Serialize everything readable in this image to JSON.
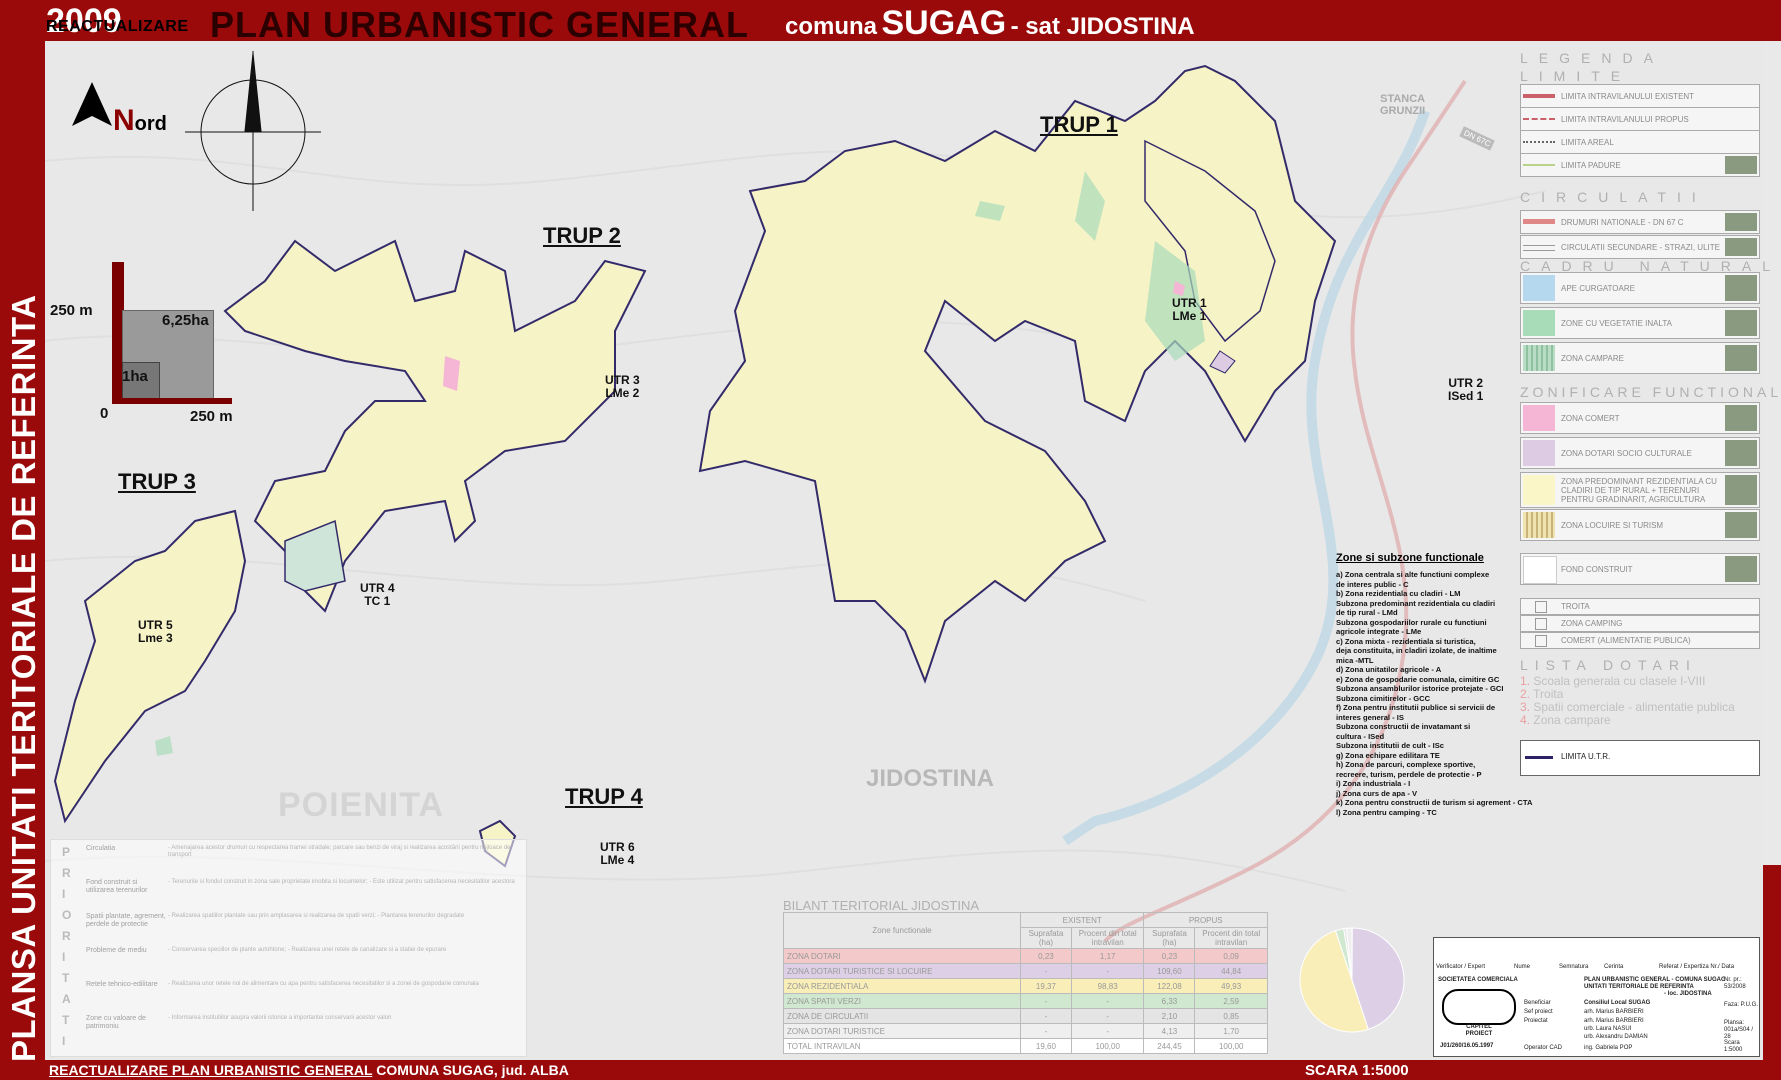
{
  "header": {
    "year": "2009",
    "reactualizare": "REACTUALIZARE",
    "main_title": "PLAN URBANISTIC GENERAL",
    "comuna_prefix": "comuna",
    "comuna_name": "SUGAG",
    "sat": "- sat JIDOSTINA"
  },
  "vertical_title": "PLANSA UNITATI TERITORIALE DE REFERINTA",
  "footer": {
    "left_part1": "REACTUALIZARE PLAN URBANISTIC GENERAL",
    "left_part2": "COMUNA SUGAG",
    "left_part3": ", jud. ALBA",
    "scale": "SCARA 1:5000"
  },
  "north": {
    "n": "N",
    "rest": "ord"
  },
  "scale_graphic": {
    "label_250_left": "250 m",
    "label_625": "6,25ha",
    "label_1ha": "1ha",
    "label_0": "0",
    "label_250_bottom": "250 m"
  },
  "trups": [
    {
      "label": "TRUP 1"
    },
    {
      "label": "TRUP 2"
    },
    {
      "label": "TRUP 3"
    },
    {
      "label": "TRUP 4"
    }
  ],
  "utrs": [
    {
      "line1": "UTR 1",
      "line2": "LMe 1"
    },
    {
      "line1": "UTR 2",
      "line2": "ISed 1"
    },
    {
      "line1": "UTR 3",
      "line2": "LMe 2"
    },
    {
      "line1": "UTR 4",
      "line2": "TC 1"
    },
    {
      "line1": "UTR 5",
      "line2": "Lme 3"
    },
    {
      "line1": "UTR 6",
      "line2": "LMe 4"
    }
  ],
  "places": {
    "poienita": "POIENITA",
    "jidostina": "JIDOSTINA",
    "stanca": "STANCA",
    "grunzii": "GRUNZII",
    "road": "DN 67C"
  },
  "legend": {
    "title": "LEGENDA",
    "limite_head": "LIMITE",
    "limite": [
      {
        "label": "LIMITA INTRAVILANULUI EXISTENT"
      },
      {
        "label": "LIMITA INTRAVILANULUI PROPUS"
      },
      {
        "label": "LIMITA AREAL"
      },
      {
        "label": "LIMITA PADURE"
      }
    ],
    "circulatii_head": "CIRCULATII",
    "circulatii": [
      {
        "label": "DRUMURI NATIONALE - DN 67 C"
      },
      {
        "label": "CIRCULATII SECUNDARE - STRAZI, ULITE"
      }
    ],
    "cadru_head": "CADRU NATURAL",
    "cadru": [
      {
        "label": "APE CURGATOARE",
        "color": "#b5d8ef"
      },
      {
        "label": "ZONE CU VEGETATIE INALTA",
        "color": "#a8dcb8"
      },
      {
        "label": "ZONA CAMPARE",
        "color": "#b8dcc4"
      }
    ],
    "zonificare_head": "ZONIFICARE FUNCTIONALA",
    "zonificare": [
      {
        "label": "ZONA COMERT",
        "color": "#f4b6d4"
      },
      {
        "label": "ZONA DOTARI SOCIO CULTURALE",
        "color": "#dccbe3"
      },
      {
        "label": "ZONA PREDOMINANT REZIDENTIALA CU CLADIRI DE TIP RURAL + TERENURI PENTRU GRADINARIT, AGRICULTURA",
        "color": "#fbf6c8"
      },
      {
        "label": "ZONA LOCUIRE SI TURISM",
        "color": "#efe4b0"
      },
      {
        "label": "FOND CONSTRUIT",
        "color": "#ffffff"
      }
    ],
    "small": [
      {
        "label": "TROITA"
      },
      {
        "label": "ZONA CAMPING"
      },
      {
        "label": "COMERT (ALIMENTATIE PUBLICA)"
      }
    ],
    "dotari_head": "LISTA DOTARI",
    "dotari": [
      {
        "n": "1.",
        "label": "Scoala generala cu clasele I-VIII"
      },
      {
        "n": "2.",
        "label": "Troita"
      },
      {
        "n": "3.",
        "label": "Spatii comerciale - alimentatie publica"
      },
      {
        "n": "4.",
        "label": "Zona campare"
      }
    ],
    "utr_limit": "LIMITA U.T.R."
  },
  "zones": {
    "title": "Zone si subzone functionale",
    "items": [
      "a) Zona centrala si alte functiuni complexe",
      "de interes public - C",
      "b) Zona rezidentiala cu cladiri - LM",
      "Subzona predominant rezidentiala cu cladiri",
      "de tip rural - LMd",
      "Subzona gospodariilor rurale cu functiuni",
      "agricole integrate - LMe",
      "c) Zona mixta - rezidentiala si turistica,",
      "deja constituita, in cladiri izolate, de inaltime",
      "mica -MTL",
      "d) Zona unitatilor agricole - A",
      "e) Zona de gospodarie comunala, cimitire GC",
      "Subzona ansamblurilor istorice protejate - GCI",
      "Subzona cimitirelor - GCC",
      "f) Zona pentru institutii publice si servicii de",
      "interes general - IS",
      "Subzona constructii de invatamant si",
      "cultura - ISed",
      "Subzona institutii de cult - ISc",
      "g) Zona echipare edilitara TE",
      "h) Zona de parcuri, complexe sportive,",
      "recreere, turism, perdele de protectie - P",
      "i) Zona industriala - I",
      "j) Zona curs de apa - V",
      "k) Zona pentru constructii de turism si agrement - CTA",
      "l) Zona pentru camping - TC"
    ]
  },
  "bilant": {
    "title": "BILANT TERITORIAL JIDOSTINA",
    "head_zone": "Zone functionale",
    "head_existent": "EXISTENT",
    "head_propus": "PROPUS",
    "head_sup": "Suprafata (ha)",
    "head_proc": "Procent din total intravilan",
    "rows": [
      {
        "name": "ZONA DOTARI",
        "e_sup": "0,23",
        "e_proc": "1,17",
        "p_sup": "0,23",
        "p_proc": "0,09",
        "color": "#f3c9c9"
      },
      {
        "name": "ZONA DOTARI TURISTICE SI LOCUIRE",
        "e_sup": "-",
        "e_proc": "-",
        "p_sup": "109,60",
        "p_proc": "44,84",
        "color": "#ddd0e6"
      },
      {
        "name": "ZONA REZIDENTIALA",
        "e_sup": "19,37",
        "e_proc": "98,83",
        "p_sup": "122,08",
        "p_proc": "49,93",
        "color": "#f9eeb8"
      },
      {
        "name": "ZONA SPATII VERZI",
        "e_sup": "-",
        "e_proc": "-",
        "p_sup": "6,33",
        "p_proc": "2,59",
        "color": "#cfe8cf"
      },
      {
        "name": "ZONA DE CIRCULATII",
        "e_sup": "-",
        "e_proc": "-",
        "p_sup": "2,10",
        "p_proc": "0,85",
        "color": "#e4e4e4"
      },
      {
        "name": "ZONA DOTARI TURISTICE",
        "e_sup": "-",
        "e_proc": "-",
        "p_sup": "4,13",
        "p_proc": "1,70",
        "color": "#efefef"
      },
      {
        "name": "TOTAL INTRAVILAN",
        "e_sup": "19,60",
        "e_proc": "100,00",
        "p_sup": "244,45",
        "p_proc": "100,00",
        "color": "#ffffff"
      }
    ]
  },
  "priorities": {
    "letters": [
      "P",
      "R",
      "I",
      "O",
      "R",
      "I",
      "T",
      "A",
      "T",
      "I"
    ],
    "rows": [
      {
        "cat": "Circulatia",
        "txt": "- Amenajarea acestor drumuri cu respectarea tramei stradale; parcare sau benzi de viraj si realizarea acostării pentru mijloace de transport"
      },
      {
        "cat": "Fond construit si utilizarea terenurilor",
        "txt": "- Terenurile si fondul construit in zona sale proprietate imobila si locuintelor; - Este utilizat pentru satisfacerea necesitatilor acestora"
      },
      {
        "cat": "Spatii plantate, agrement, perdele de protectie",
        "txt": "- Realizarea spatiilor plantate sau prin amplasarea si realizarea de spatii verzi; - Plantarea terenurilor degradate"
      },
      {
        "cat": "Probleme de mediu",
        "txt": "- Conservarea speciilor de plante autohtone; - Realizarea unei retele de canalizare si a statiei de epurare"
      },
      {
        "cat": "Retele tehnico-edilitare",
        "txt": "- Realizarea unor retele noi de alimentare cu apa pentru satisfacerea necesitatilor si a zonei de gospodarie comunala"
      },
      {
        "cat": "Zone cu valoare de patrimoniu",
        "txt": "- Informarea institutiilor asupra valorii istorice a importantei conservarii acestor valori"
      }
    ]
  },
  "cartouche": {
    "firm": "SOCIETATEA COMERCIALA",
    "logo": "CAPITEL PROIECT",
    "reg": "J01/260/16.05.1997",
    "verif": "Verificator / Expert",
    "name": "Nume",
    "sign": "Semnatura",
    "cerinta": "Cerinta",
    "referat": "Referat / Expertiza Nr./ Data",
    "project_title": "PLAN URBANISTIC GENERAL - COMUNA SUGAG",
    "plan_title": "UNITATI TERITORIALE DE REFERINTA",
    "loc": "- loc. JIDOSTINA",
    "benef_label": "Beneficiar",
    "benef": "Consiliul Local SUGAG",
    "sef_label": "Sef proiect",
    "sef": "arh. Marius BARBIERI",
    "proiectat_label": "Proiectat",
    "proiectat": "arh. Marius BARBIERI",
    "p2": "urb. Laura NASUI",
    "p3": "urb. Alexandru DAMIAN",
    "cad_label": "Operator CAD",
    "cad": "ing. Gabriela POP",
    "faza": "Faza: P.U.G.",
    "nr": "Nr. pr.: 53/2008",
    "plansa": "Plansa: 001a/S04 / 28",
    "scara": "Scara 1:5000"
  }
}
